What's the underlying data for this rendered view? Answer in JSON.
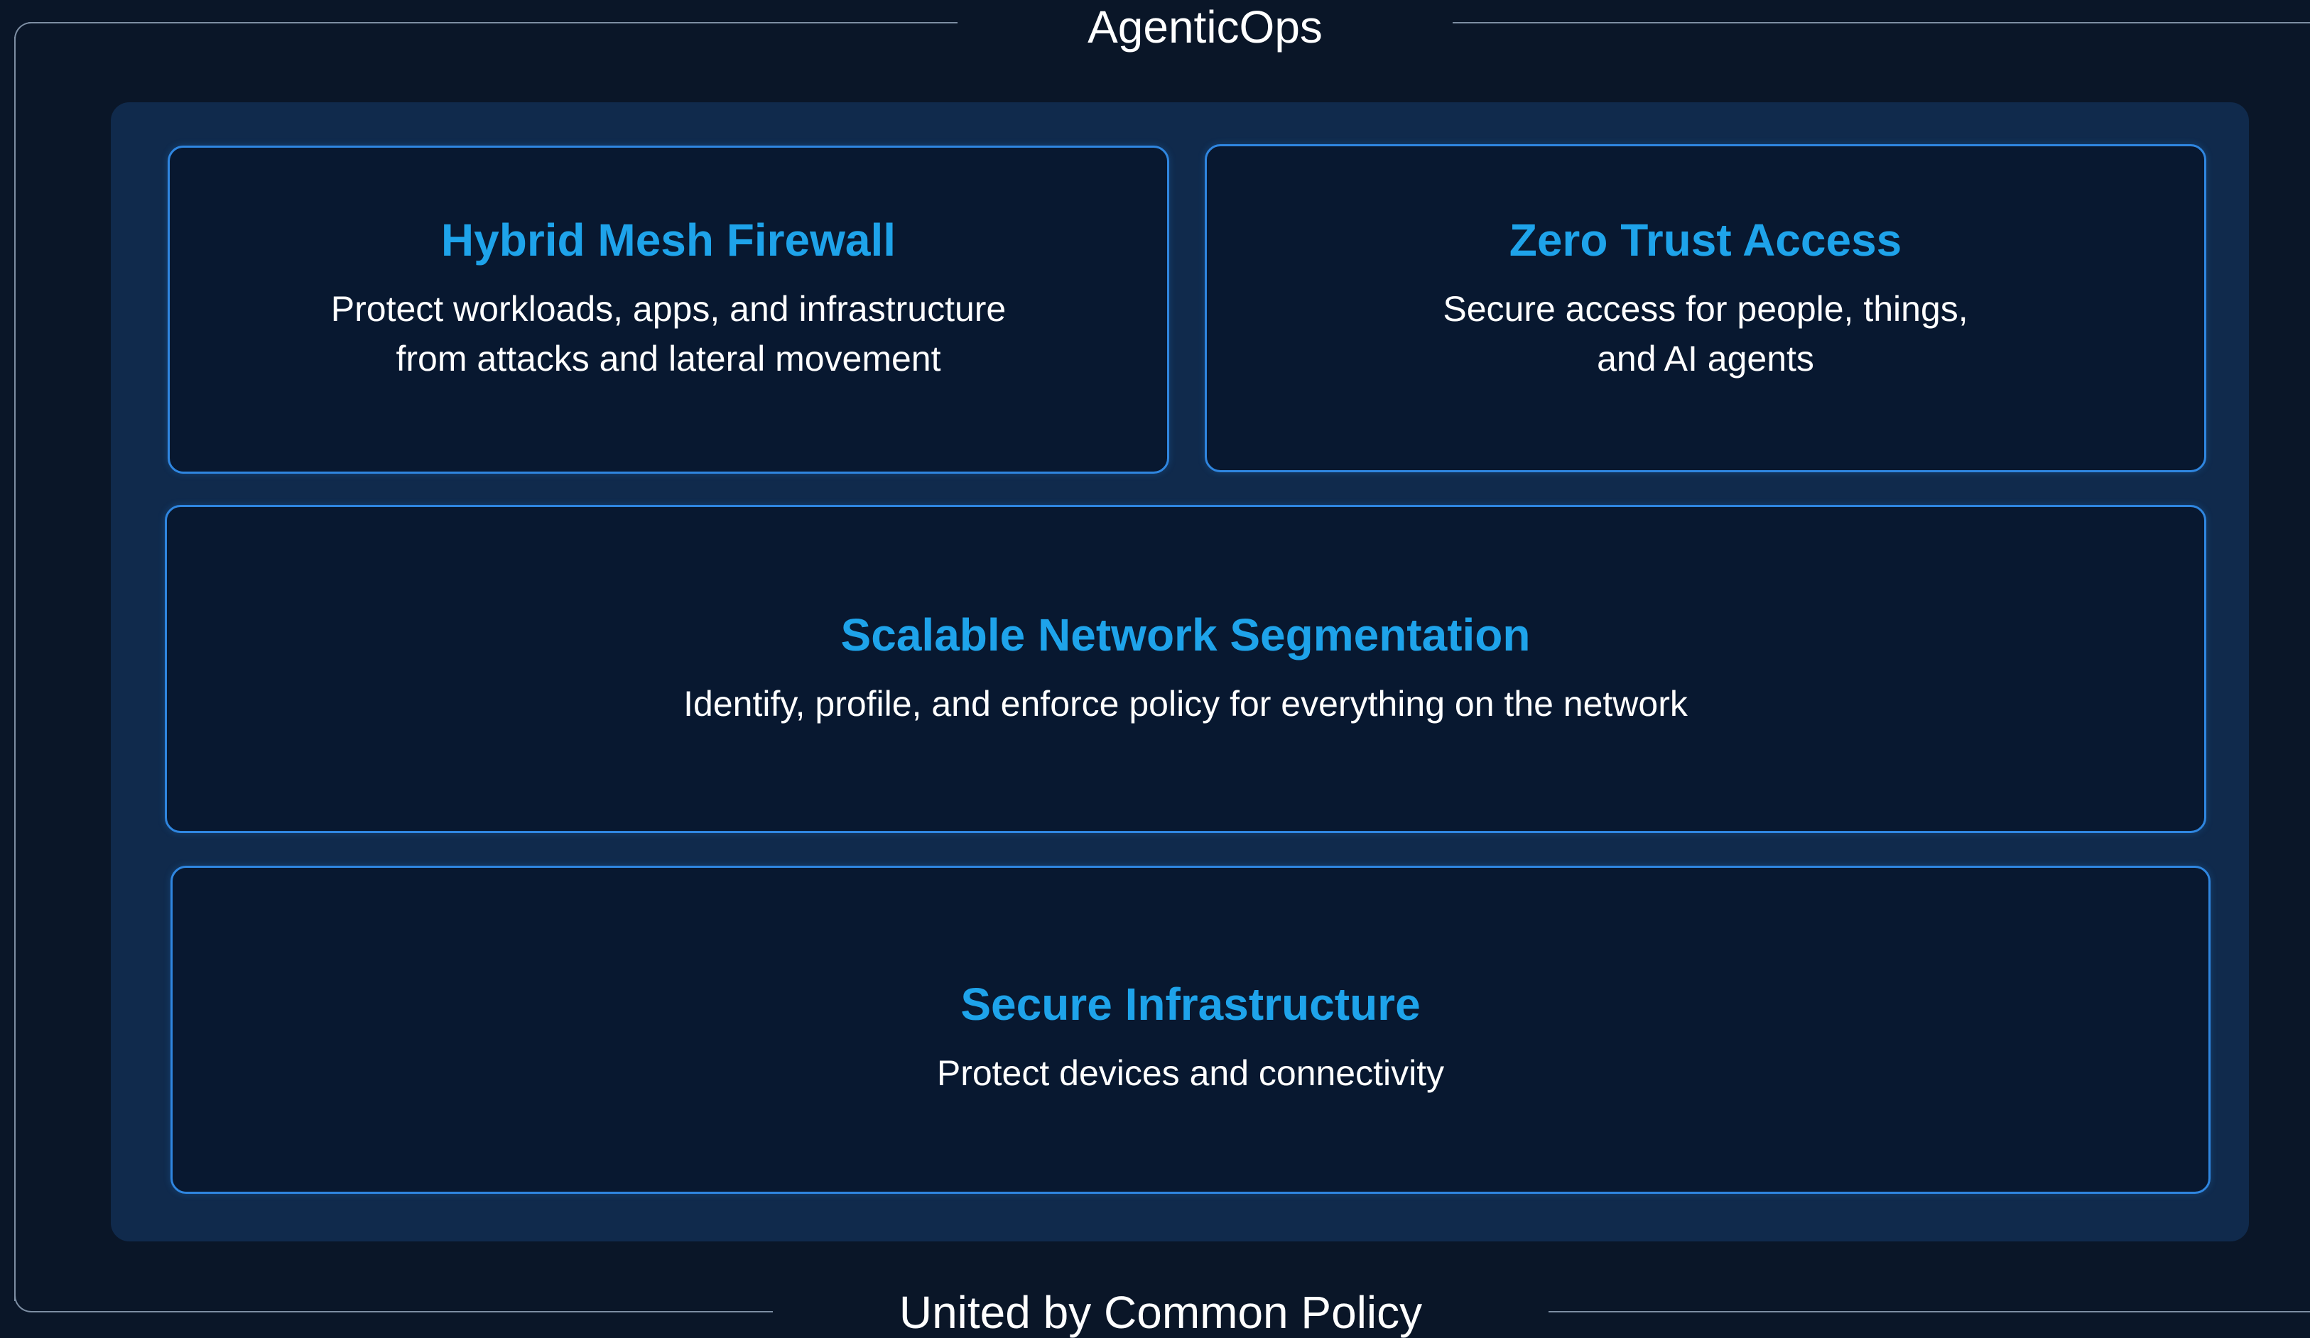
{
  "top_label": "AgenticOps",
  "bottom_label": "United by Common Policy",
  "cards": [
    {
      "title": "Hybrid Mesh Firewall",
      "desc_line1": "Protect workloads, apps, and infrastructure",
      "desc_line2": "from attacks and lateral movement"
    },
    {
      "title": "Zero Trust Access",
      "desc_line1": "Secure access for people, things,",
      "desc_line2": "and AI agents"
    },
    {
      "title": "Scalable Network Segmentation",
      "desc_line1": "Identify, profile, and enforce policy for everything on the network"
    },
    {
      "title": "Secure Infrastructure",
      "desc_line1": "Protect devices and connectivity"
    }
  ],
  "colors": {
    "background": "#0a1628",
    "panel": "#102a4c",
    "card_fill": "#081830",
    "card_border": "#2f86e0",
    "title_accent": "#1ea3ea",
    "text": "#ffffff"
  }
}
